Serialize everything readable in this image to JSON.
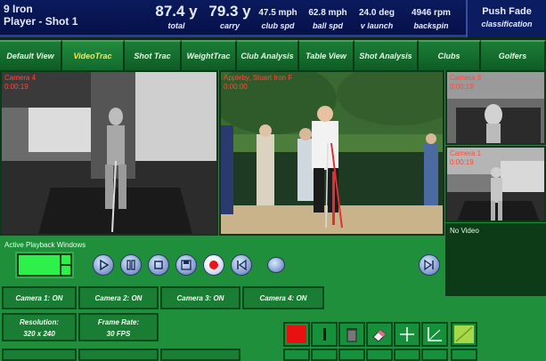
{
  "header": {
    "club": "9 Iron",
    "player": "Player - Shot 1",
    "metrics": [
      {
        "value": "87.4 y",
        "label": "total"
      },
      {
        "value": "79.3 y",
        "label": "carry"
      },
      {
        "value": "47.5 mph",
        "label": "club spd"
      },
      {
        "value": "62.8 mph",
        "label": "ball spd"
      },
      {
        "value": "24.0 deg",
        "label": "v launch"
      },
      {
        "value": "4946 rpm",
        "label": "backspin"
      }
    ],
    "classification": {
      "value": "Push Fade",
      "label": "classification"
    }
  },
  "nav": {
    "tabs": [
      "Default View",
      "VideoTrac",
      "Shot Trac",
      "WeightTrac",
      "Club Analysis",
      "Table View",
      "Shot Analysis",
      "Clubs",
      "Golfers"
    ],
    "active_index": 1
  },
  "cameras": {
    "cam4": {
      "label": "Camera 4",
      "time": "0:00:19"
    },
    "main": {
      "label": "Appleby, Stuart Iron F",
      "time": "0:00:00"
    },
    "cam3": {
      "label": "Camera 3",
      "time": "0:00:19"
    },
    "cam1": {
      "label": "Camera 1",
      "time": "0:00:19"
    },
    "novideo": {
      "label": "No Video"
    }
  },
  "playback": {
    "label": "Active Playback Windows"
  },
  "camera_buttons": [
    "Camera 1: ON",
    "Camera 2: ON",
    "Camera 3: ON",
    "Camera 4: ON"
  ],
  "settings": {
    "resolution_label": "Resolution:",
    "resolution_value": "320 x 240",
    "framerate_label": "Frame Rate:",
    "framerate_value": "30 FPS"
  },
  "colors": {
    "header_bg": "#0a1a5c",
    "panel_green": "#1f8f3c",
    "active_tab_text": "#ffe84a",
    "camera_label": "#ff4a3a"
  }
}
